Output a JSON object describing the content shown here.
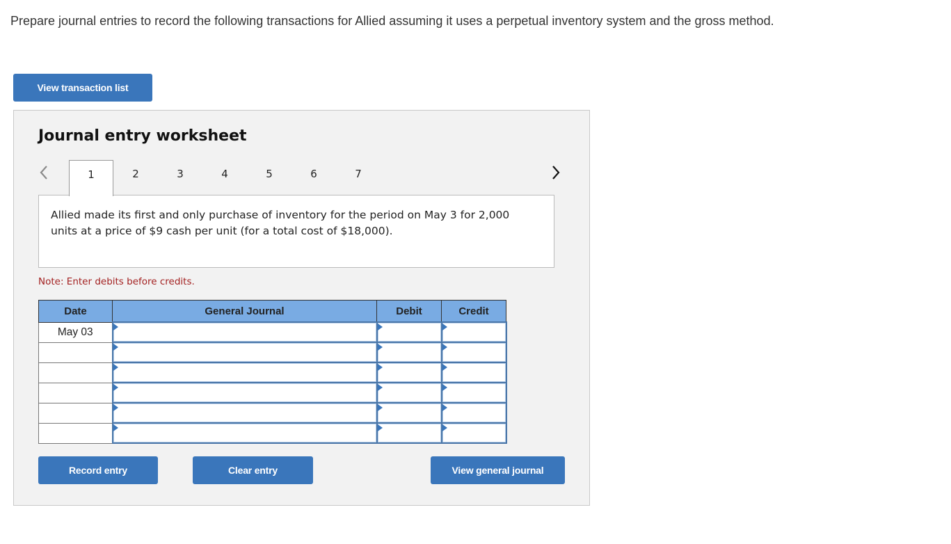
{
  "prompt": "Prepare journal entries to record the following transactions for Allied assuming it uses a perpetual inventory system and the gross method.",
  "view_transaction_list_label": "View transaction list",
  "worksheet": {
    "title": "Journal entry worksheet",
    "tabs": [
      {
        "label": "1",
        "active": true
      },
      {
        "label": "2",
        "active": false
      },
      {
        "label": "3",
        "active": false
      },
      {
        "label": "4",
        "active": false
      },
      {
        "label": "5",
        "active": false
      },
      {
        "label": "6",
        "active": false
      },
      {
        "label": "7",
        "active": false
      }
    ],
    "prev_icon": "chevron-left-icon",
    "next_icon": "chevron-right-icon",
    "description": "Allied made its first and only purchase of inventory for the period on May 3 for 2,000 units at a price of $9 cash per unit (for a total cost of $18,000).",
    "note": "Note: Enter debits before credits.",
    "table": {
      "headers": [
        "Date",
        "General Journal",
        "Debit",
        "Credit"
      ],
      "rows": [
        {
          "date": "May 03",
          "account": "",
          "debit": "",
          "credit": ""
        },
        {
          "date": "",
          "account": "",
          "debit": "",
          "credit": ""
        },
        {
          "date": "",
          "account": "",
          "debit": "",
          "credit": ""
        },
        {
          "date": "",
          "account": "",
          "debit": "",
          "credit": ""
        },
        {
          "date": "",
          "account": "",
          "debit": "",
          "credit": ""
        },
        {
          "date": "",
          "account": "",
          "debit": "",
          "credit": ""
        }
      ]
    },
    "buttons": {
      "record": "Record entry",
      "clear": "Clear entry",
      "view_general_journal": "View general journal"
    }
  },
  "colors": {
    "button": "#3a76bb",
    "table_header": "#79abe3",
    "note_text": "#a32020",
    "panel_bg": "#f2f2f2"
  }
}
